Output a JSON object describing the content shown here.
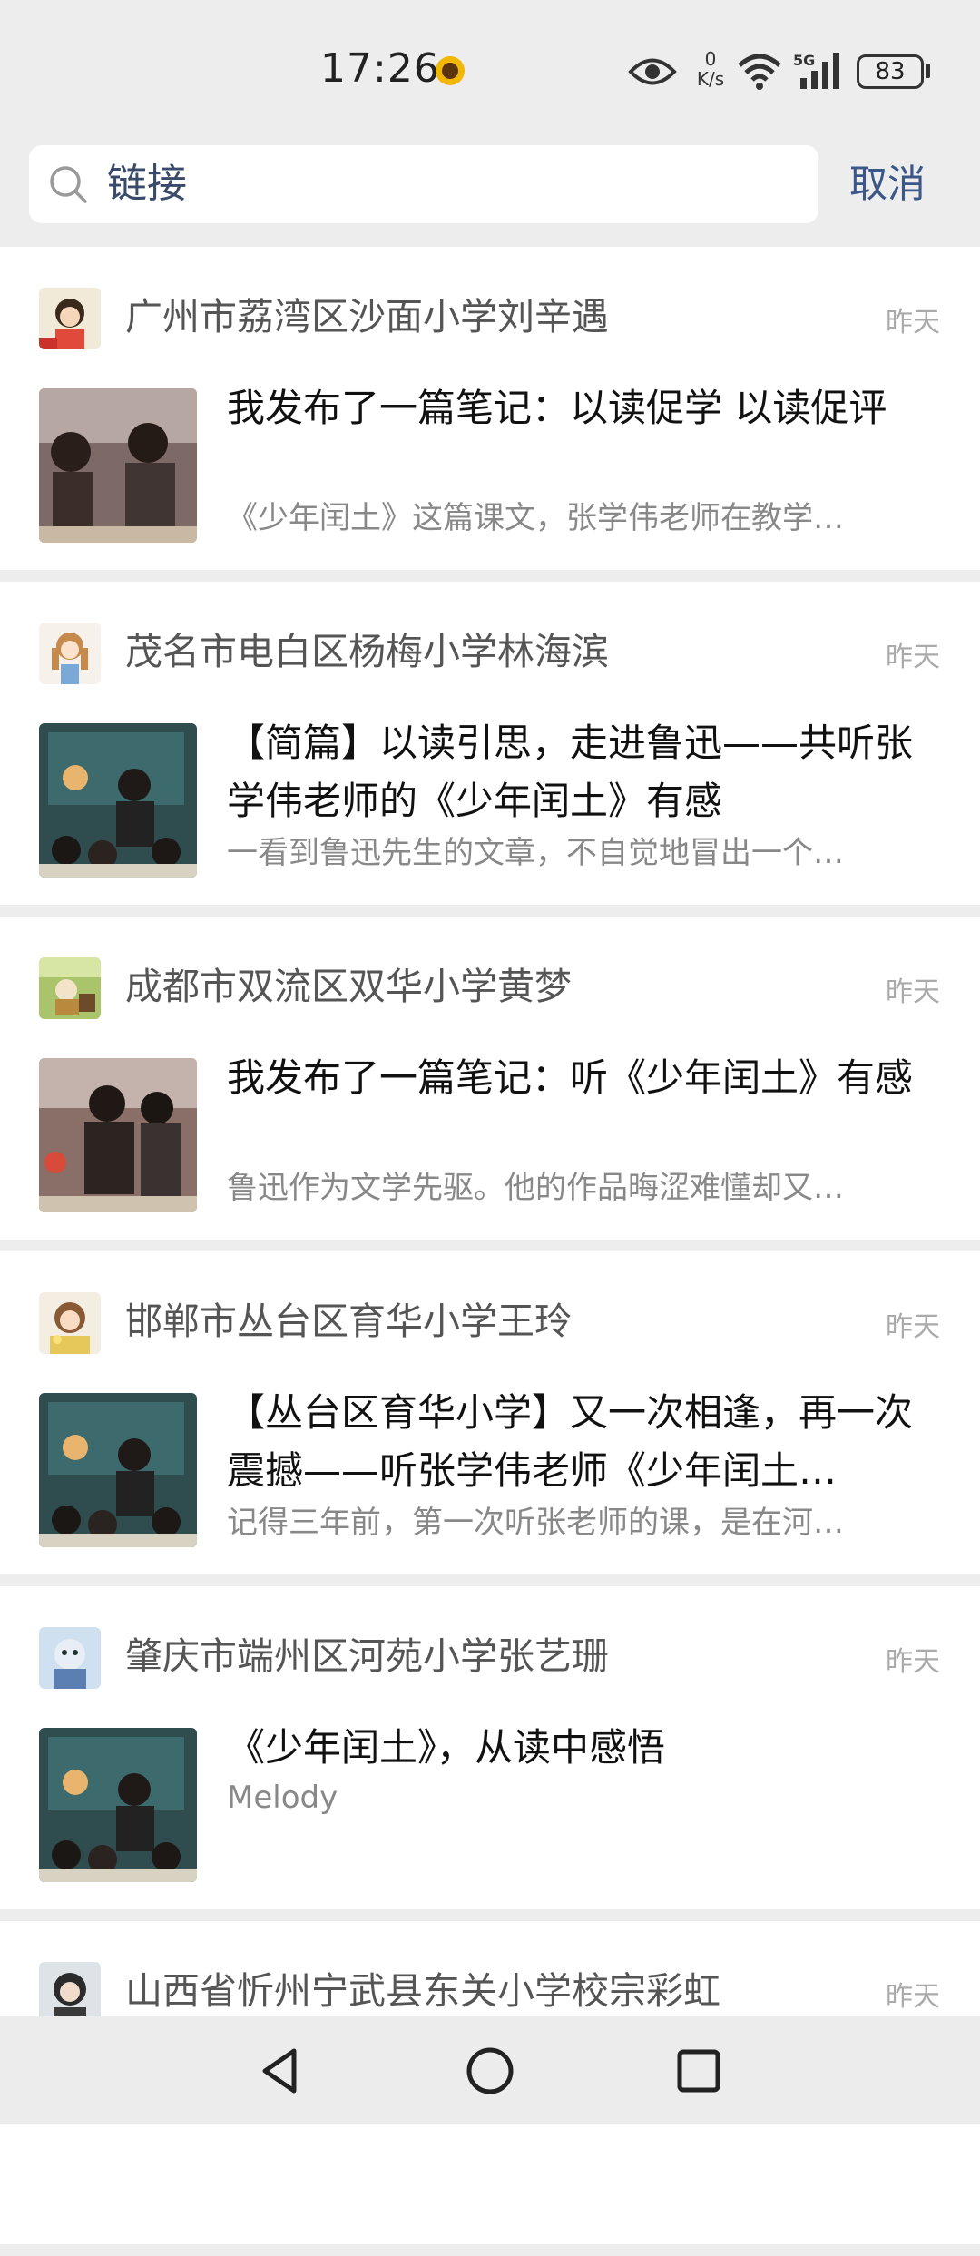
{
  "status_bar": {
    "time": "17:26",
    "net_speed_value": "0",
    "net_speed_unit": "K/s",
    "network": "5G",
    "battery": "83"
  },
  "search": {
    "query": "链接",
    "cancel_label": "取消"
  },
  "results": [
    {
      "author": "广州市荔湾区沙面小学刘辛遇",
      "date": "昨天",
      "title": "我发布了一篇笔记：以读促学 以读促评",
      "excerpt": "《少年闰土》这篇课文，张学伟老师在教学…"
    },
    {
      "author": "茂名市电白区杨梅小学林海滨",
      "date": "昨天",
      "title": "【简篇】以读引思，走进鲁迅——共听张学伟老师的《少年闰土》有感",
      "excerpt": "一看到鲁迅先生的文章，不自觉地冒出一个…"
    },
    {
      "author": "成都市双流区双华小学黄梦",
      "date": "昨天",
      "title": "我发布了一篇笔记：听《少年闰土》有感",
      "excerpt": "鲁迅作为文学先驱。他的作品晦涩难懂却又…"
    },
    {
      "author": "邯郸市丛台区育华小学王玲",
      "date": "昨天",
      "title": "【丛台区育华小学】又一次相逢，再一次震撼——听张学伟老师《少年闰土…",
      "excerpt": "记得三年前，第一次听张老师的课，是在河…"
    },
    {
      "author": "肇庆市端州区河苑小学张艺珊",
      "date": "昨天",
      "title": "《少年闰土》，从读中感悟",
      "excerpt": "Melody"
    },
    {
      "author": "山西省忻州宁武县东关小学校宗彩虹",
      "date": "昨天",
      "title": "",
      "excerpt": ""
    }
  ]
}
